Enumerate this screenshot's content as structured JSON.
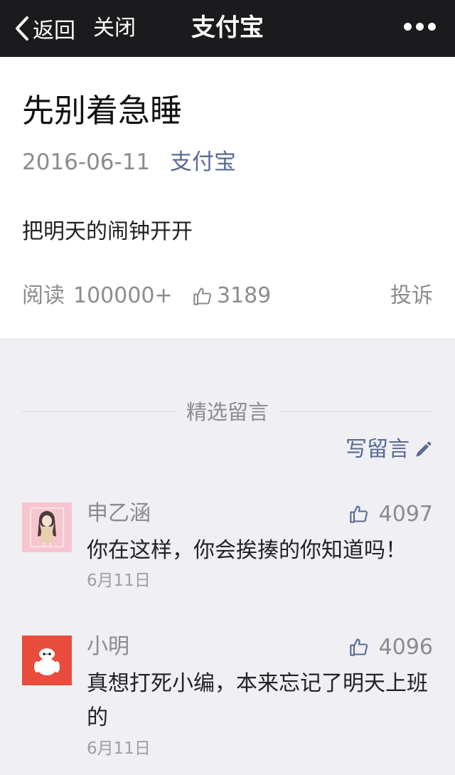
{
  "nav": {
    "back_label": "返回",
    "close_label": "关闭",
    "title": "支付宝",
    "bar_color": "#1b1b1d"
  },
  "article": {
    "title": "先别着急睡",
    "date": "2016-06-11",
    "source": "支付宝",
    "body": "把明天的闹钟开开",
    "read_label": "阅读",
    "read_count": "100000+",
    "like_count": "3189",
    "report_label": "投诉"
  },
  "comments_section": {
    "header": "精选留言",
    "write_label": "写留言",
    "items": [
      {
        "name": "申乙涵",
        "likes": "4097",
        "text": "你在这样，你会挨揍的你知道吗！",
        "date": "6月11日",
        "avatar_icon": "girl-avatar-icon"
      },
      {
        "name": "小明",
        "likes": "4096",
        "text": "真想打死小编，本来忘记了明天上班的",
        "date": "6月11日",
        "avatar_icon": "baymax-avatar-icon"
      }
    ]
  },
  "colors": {
    "link": "#576b95",
    "meta_gray": "#8c8c8c",
    "page_bg": "#efeff4"
  }
}
